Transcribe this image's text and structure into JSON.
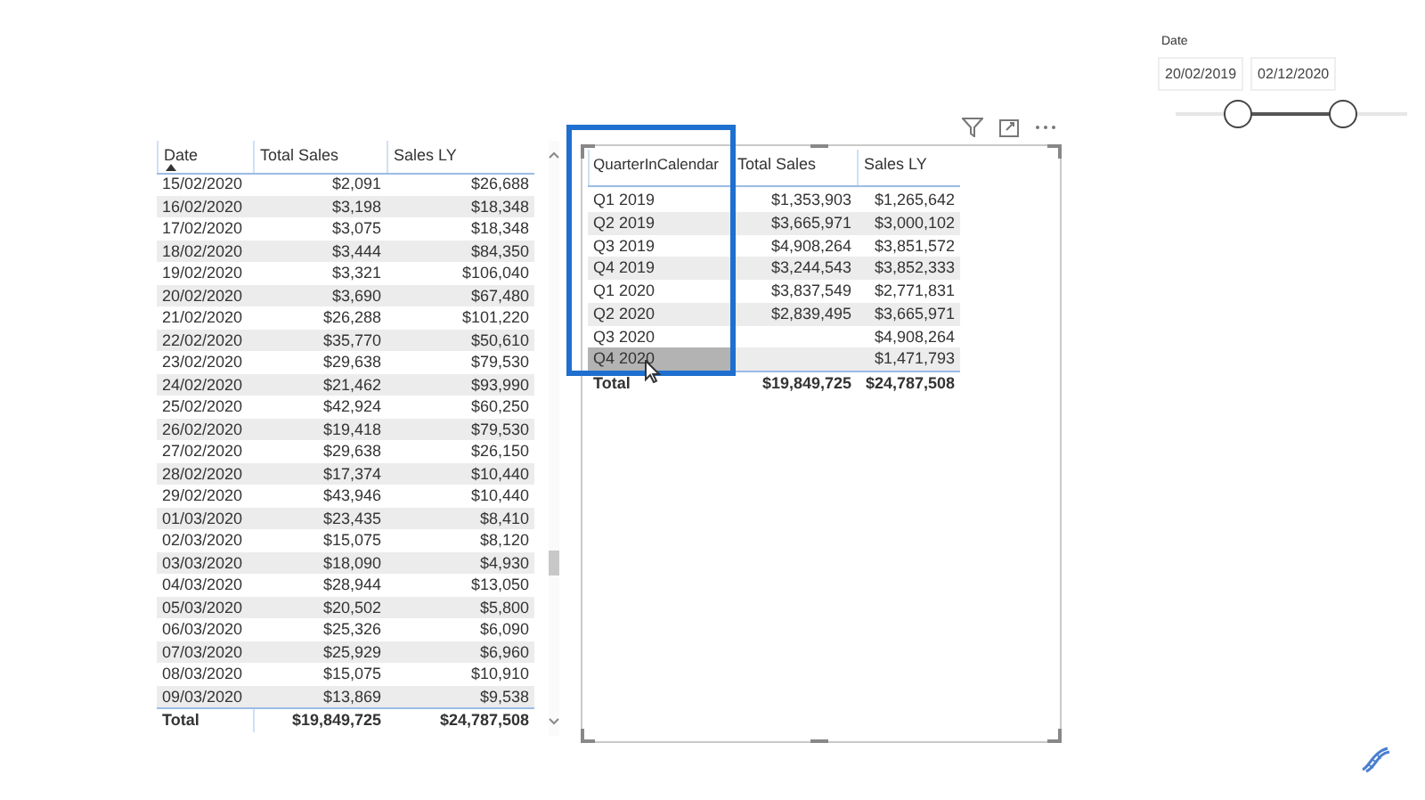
{
  "date_table": {
    "columns": [
      "Date",
      "Total Sales",
      "Sales LY"
    ],
    "rows": [
      [
        "15/02/2020",
        "$2,091",
        "$26,688"
      ],
      [
        "16/02/2020",
        "$3,198",
        "$18,348"
      ],
      [
        "17/02/2020",
        "$3,075",
        "$18,348"
      ],
      [
        "18/02/2020",
        "$3,444",
        "$84,350"
      ],
      [
        "19/02/2020",
        "$3,321",
        "$106,040"
      ],
      [
        "20/02/2020",
        "$3,690",
        "$67,480"
      ],
      [
        "21/02/2020",
        "$26,288",
        "$101,220"
      ],
      [
        "22/02/2020",
        "$35,770",
        "$50,610"
      ],
      [
        "23/02/2020",
        "$29,638",
        "$79,530"
      ],
      [
        "24/02/2020",
        "$21,462",
        "$93,990"
      ],
      [
        "25/02/2020",
        "$42,924",
        "$60,250"
      ],
      [
        "26/02/2020",
        "$19,418",
        "$79,530"
      ],
      [
        "27/02/2020",
        "$29,638",
        "$26,150"
      ],
      [
        "28/02/2020",
        "$17,374",
        "$10,440"
      ],
      [
        "29/02/2020",
        "$43,946",
        "$10,440"
      ],
      [
        "01/03/2020",
        "$23,435",
        "$8,410"
      ],
      [
        "02/03/2020",
        "$15,075",
        "$8,120"
      ],
      [
        "03/03/2020",
        "$18,090",
        "$4,930"
      ],
      [
        "04/03/2020",
        "$28,944",
        "$13,050"
      ],
      [
        "05/03/2020",
        "$20,502",
        "$5,800"
      ],
      [
        "06/03/2020",
        "$25,326",
        "$6,090"
      ],
      [
        "07/03/2020",
        "$25,929",
        "$6,960"
      ],
      [
        "08/03/2020",
        "$15,075",
        "$10,910"
      ],
      [
        "09/03/2020",
        "$13,869",
        "$9,538"
      ]
    ],
    "total": [
      "Total",
      "$19,849,725",
      "$24,787,508"
    ]
  },
  "quarter_table": {
    "columns": [
      "QuarterInCalendar",
      "Total Sales",
      "Sales LY"
    ],
    "rows": [
      {
        "cells": [
          "Q1 2019",
          "$1,353,903",
          "$1,265,642"
        ],
        "selected": false
      },
      {
        "cells": [
          "Q2 2019",
          "$3,665,971",
          "$3,000,102"
        ],
        "selected": false
      },
      {
        "cells": [
          "Q3 2019",
          "$4,908,264",
          "$3,851,572"
        ],
        "selected": false
      },
      {
        "cells": [
          "Q4 2019",
          "$3,244,543",
          "$3,852,333"
        ],
        "selected": false
      },
      {
        "cells": [
          "Q1 2020",
          "$3,837,549",
          "$2,771,831"
        ],
        "selected": false
      },
      {
        "cells": [
          "Q2 2020",
          "$2,839,495",
          "$3,665,971"
        ],
        "selected": false
      },
      {
        "cells": [
          "Q3 2020",
          "",
          "$4,908,264"
        ],
        "selected": false
      },
      {
        "cells": [
          "Q4 2020",
          "",
          "$1,471,793"
        ],
        "selected": true
      }
    ],
    "total": [
      "Total",
      "$19,849,725",
      "$24,787,508"
    ]
  },
  "date_slicer": {
    "title": "Date",
    "start": "20/02/2019",
    "end": "02/12/2020",
    "handles": [
      {
        "level": 0.27
      },
      {
        "level": 0.72
      }
    ]
  }
}
